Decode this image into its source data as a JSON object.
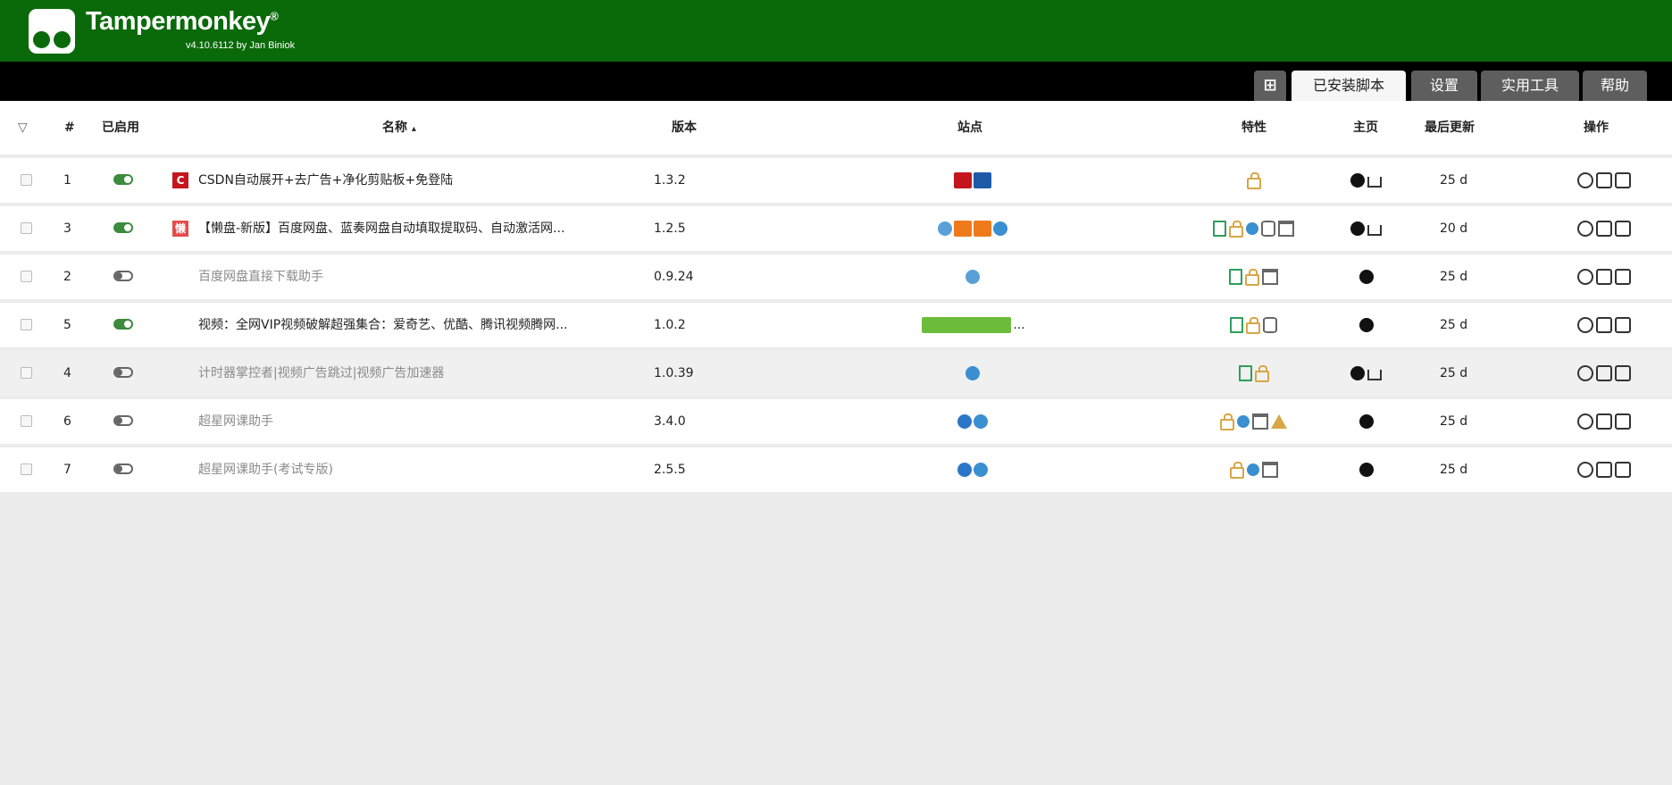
{
  "app": {
    "title": "Tampermonkey",
    "trademark": "®",
    "version_line": "v4.10.6112 by Jan Biniok"
  },
  "tabs": [
    {
      "label": "⊞",
      "icon": "add-script-icon"
    },
    {
      "label": "已安装脚本",
      "active": true
    },
    {
      "label": "设置"
    },
    {
      "label": "实用工具"
    },
    {
      "label": "帮助"
    }
  ],
  "table": {
    "headers": {
      "filter": "▽",
      "num": "#",
      "enabled": "已启用",
      "name": "名称",
      "sort_arrow": "▴",
      "version": "版本",
      "sites": "站点",
      "features": "特性",
      "homepage": "主页",
      "updated": "最后更新",
      "actions": "操作"
    },
    "rows": [
      {
        "num": "1",
        "enabled": true,
        "favicon": "C",
        "name": "CSDN自动展开+去广告+净化剪贴板+免登陆",
        "version": "1.3.2",
        "sites": [
          "csdn-c",
          "csdn-g"
        ],
        "features": [
          "lock"
        ],
        "home": [
          "dark",
          "house"
        ],
        "updated": "25 d"
      },
      {
        "num": "3",
        "enabled": true,
        "favicon": "懒",
        "name": "【懒盘-新版】百度网盘、蓝奏网盘自动填取提取码、自动激活网...",
        "version": "1.2.5",
        "sites": [
          "cloud",
          "orange1",
          "orange2",
          "globe"
        ],
        "features": [
          "doc",
          "lock",
          "globe",
          "db",
          "win"
        ],
        "home": [
          "dark",
          "house"
        ],
        "updated": "20 d"
      },
      {
        "num": "2",
        "enabled": false,
        "favicon": "",
        "name": "百度网盘直接下载助手",
        "version": "0.9.24",
        "sites": [
          "cloud"
        ],
        "features": [
          "doc",
          "lock",
          "win"
        ],
        "home": [
          "dark"
        ],
        "updated": "25 d"
      },
      {
        "num": "5",
        "enabled": true,
        "favicon": "",
        "name": "视频：全网VIP视频破解超强集合：爱奇艺、优酷、腾讯视频腾网...",
        "version": "1.0.2",
        "sites": [
          "multi"
        ],
        "sites_more": "...",
        "features": [
          "doc",
          "lock",
          "db"
        ],
        "home": [
          "dark"
        ],
        "updated": "25 d"
      },
      {
        "num": "4",
        "enabled": false,
        "favicon": "",
        "name": "计时器掌控者|视频广告跳过|视频广告加速器",
        "version": "1.0.39",
        "sites": [
          "globe"
        ],
        "features": [
          "doc",
          "lock"
        ],
        "home": [
          "dark",
          "house"
        ],
        "updated": "25 d"
      },
      {
        "num": "6",
        "enabled": false,
        "favicon": "",
        "name": "超星网课助手",
        "version": "3.4.0",
        "sites": [
          "ie",
          "clock"
        ],
        "features": [
          "lock",
          "globe",
          "win",
          "warn"
        ],
        "home": [
          "dark"
        ],
        "updated": "25 d"
      },
      {
        "num": "7",
        "enabled": false,
        "favicon": "",
        "name": "超星网课助手(考试专版)",
        "version": "2.5.5",
        "sites": [
          "ie",
          "clock"
        ],
        "features": [
          "lock",
          "globe",
          "win"
        ],
        "home": [
          "dark"
        ],
        "updated": "25 d"
      }
    ]
  },
  "colors": {
    "header_green": "#0a6a0a",
    "toggle_on": "#3d8b3d",
    "lock": "#d8a646"
  }
}
